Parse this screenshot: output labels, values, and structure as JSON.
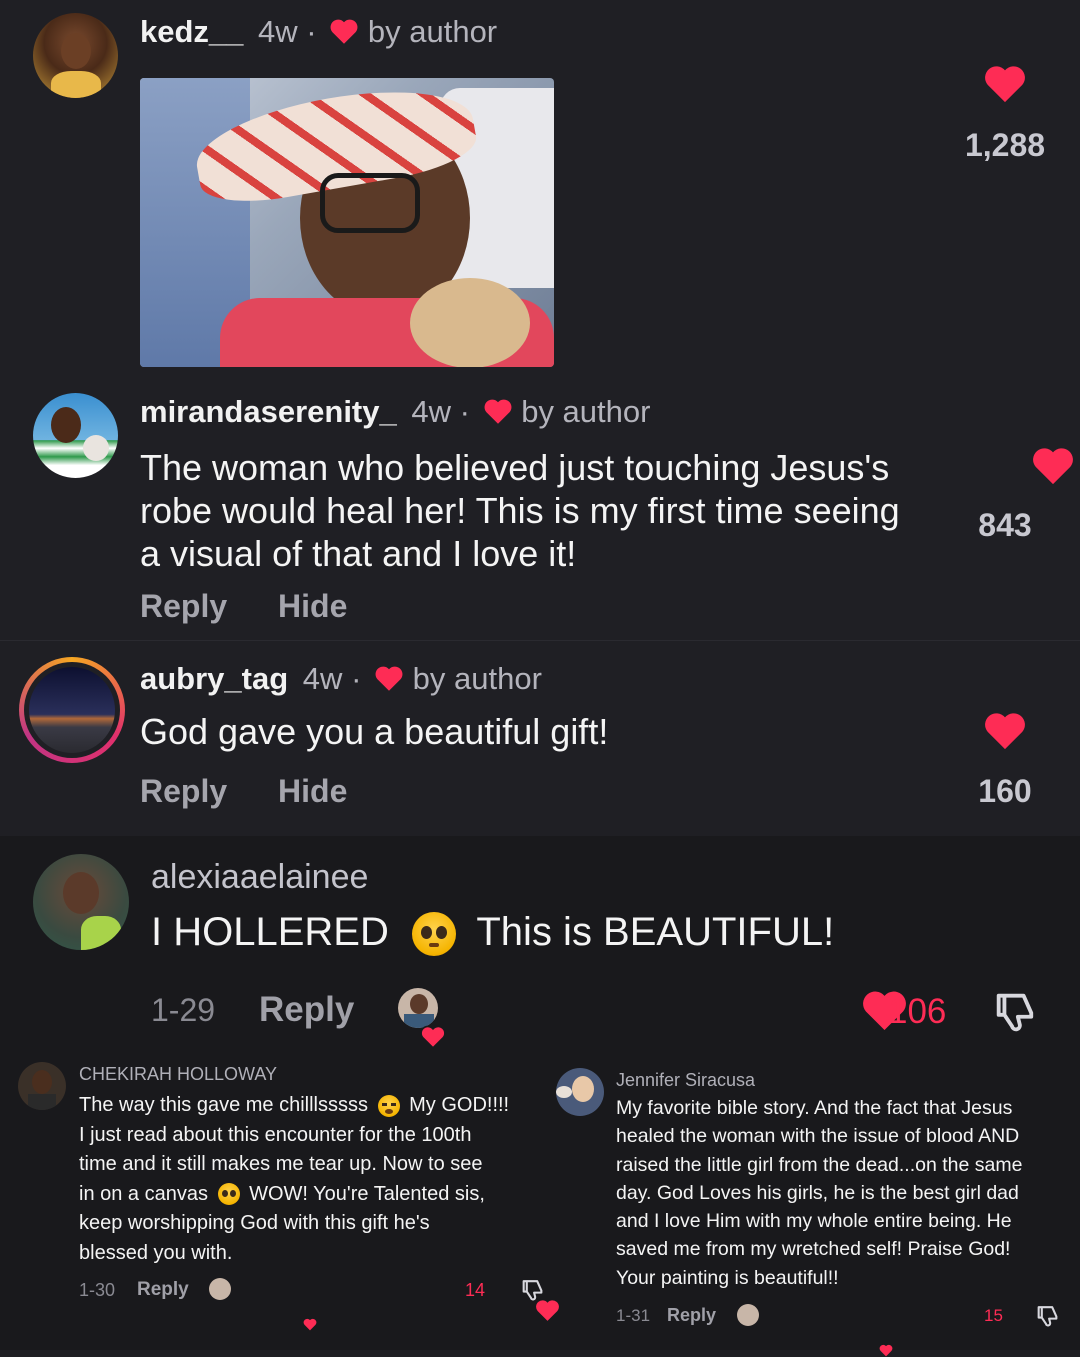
{
  "comments": [
    {
      "username": "kedz__",
      "age": "4w",
      "sep": "·",
      "liked_label": "by author",
      "likes": "1,288"
    },
    {
      "username": "mirandaserenity_",
      "age": "4w",
      "sep": "·",
      "liked_label": "by author",
      "text": "The woman who believed just touching Jesus's robe would heal her! This is my first time seeing a visual of that and I love it!",
      "likes": "843",
      "reply_label": "Reply",
      "hide_label": "Hide"
    },
    {
      "username": "aubry_tag",
      "age": "4w",
      "sep": "·",
      "liked_label": "by author",
      "text": "God gave you a beautiful gift!",
      "likes": "160",
      "reply_label": "Reply",
      "hide_label": "Hide"
    }
  ],
  "tiktok_comment": {
    "username": "alexiaaelainee",
    "text_part1": "I HOLLERED",
    "text_part2": "This is BEAUTIFUL!",
    "date": "1-29",
    "reply_label": "Reply",
    "likes": "106"
  },
  "sub_comments": [
    {
      "username": "CHEKIRAH HOLLOWAY",
      "line1a": "The way this gave me chilllsssss",
      "line1b": "My GOD!!!!",
      "line2": "I just read about this encounter for the 100th",
      "line3": "time and it still makes me tear up. Now to see",
      "line4a": "in on a canvas",
      "line4b": "WOW! You're Talented sis,",
      "line5": "keep worshipping God with this gift he's",
      "line6": "blessed you with.",
      "date": "1-30",
      "reply_label": "Reply",
      "likes": "14"
    },
    {
      "username": "Jennifer Siracusa",
      "lines": [
        "My favorite bible story. And the fact that Jesus",
        "healed the woman with the issue of blood AND",
        "raised the little girl from the dead...on the same",
        "day. God Loves his girls, he is the best girl dad",
        "and I love Him with my whole entire being. He",
        "saved me from my wretched self! Praise God!",
        "Your painting is beautiful!!"
      ],
      "date": "1-31",
      "reply_label": "Reply",
      "likes": "15"
    }
  ],
  "colors": {
    "heart": "#fe2c55",
    "accent_ring": "#e1306c"
  }
}
